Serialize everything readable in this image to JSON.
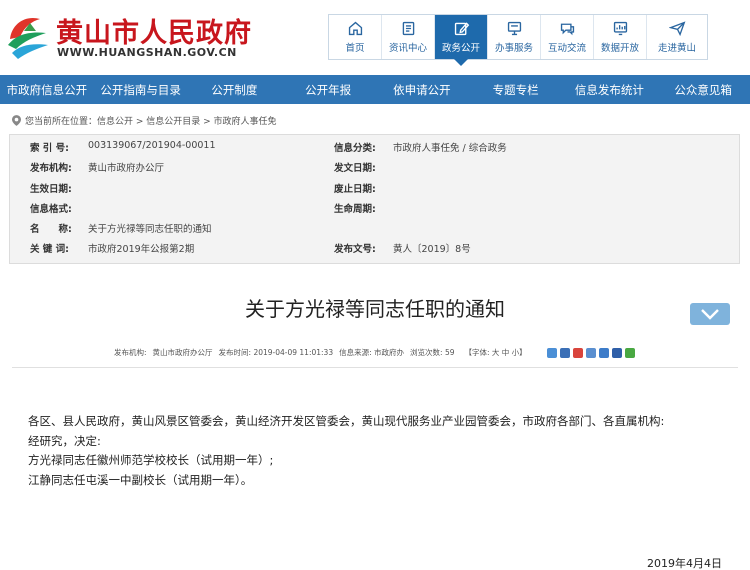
{
  "brand": {
    "title": "黄山市人民政府",
    "url": "WWW.HUANGSHAN.GOV.CN"
  },
  "topnav": [
    {
      "label": "首页",
      "icon": "home-icon"
    },
    {
      "label": "资讯中心",
      "icon": "news-icon"
    },
    {
      "label": "政务公开",
      "icon": "edit-icon",
      "active": true
    },
    {
      "label": "办事服务",
      "icon": "service-icon"
    },
    {
      "label": "互动交流",
      "icon": "chat-icon"
    },
    {
      "label": "数据开放",
      "icon": "data-icon"
    },
    {
      "label": "走进黄山",
      "icon": "send-icon"
    }
  ],
  "mainnav": [
    "市政府信息公开",
    "公开指南与目录",
    "公开制度",
    "公开年报",
    "依申请公开",
    "专题专栏",
    "信息发布统计",
    "公众意见箱"
  ],
  "breadcrumb": "您当前所在位置：信息公开 > 信息公开目录 > 市政府人事任免",
  "meta": {
    "index_label": "索 引 号:",
    "index_value": "003139067/201904-00011",
    "category_label": "信息分类:",
    "category_value": "市政府人事任免 / 综合政务",
    "publisher_label": "发布机构:",
    "publisher_value": "黄山市政府办公厅",
    "issue_date_label": "发文日期:",
    "issue_date_value": "",
    "effective_label": "生效日期:",
    "effective_value": "",
    "abolish_label": "废止日期:",
    "abolish_value": "",
    "format_label": "信息格式:",
    "format_value": "",
    "lifecycle_label": "生命周期:",
    "lifecycle_value": "",
    "name_label": "名　　称:",
    "name_value": "关于方光禄等同志任职的通知",
    "keyword_label": "关 键 词:",
    "keyword_value": "市政府2019年公报第2期",
    "docno_label": "发布文号:",
    "docno_value": "黄人〔2019〕8号"
  },
  "doc": {
    "title": "关于方光禄等同志任职的通知",
    "info_publisher": "发布机构:",
    "info_publisher_value": "黄山市政府办公厅",
    "info_time": "发布时间: 2019-04-09 11:01:33",
    "info_source": "信息来源: 市政府办",
    "info_views": "浏览次数: 59",
    "font_size": "【字体: 大 中 小】",
    "paragraphs": [
      "各区、县人民政府，黄山风景区管委会，黄山经济开发区管委会，黄山现代服务业产业园管委会，市政府各部门、各直属机构:",
      "经研究，决定:",
      "方光禄同志任徽州师范学校校长（试用期一年）;",
      "江静同志任屯溪一中副校长（试用期一年）。"
    ],
    "date": "2019年4月4日"
  },
  "colors": {
    "brand_red": "#c8161d",
    "nav_blue": "#2f75b5",
    "active_blue": "#1e6aac"
  }
}
